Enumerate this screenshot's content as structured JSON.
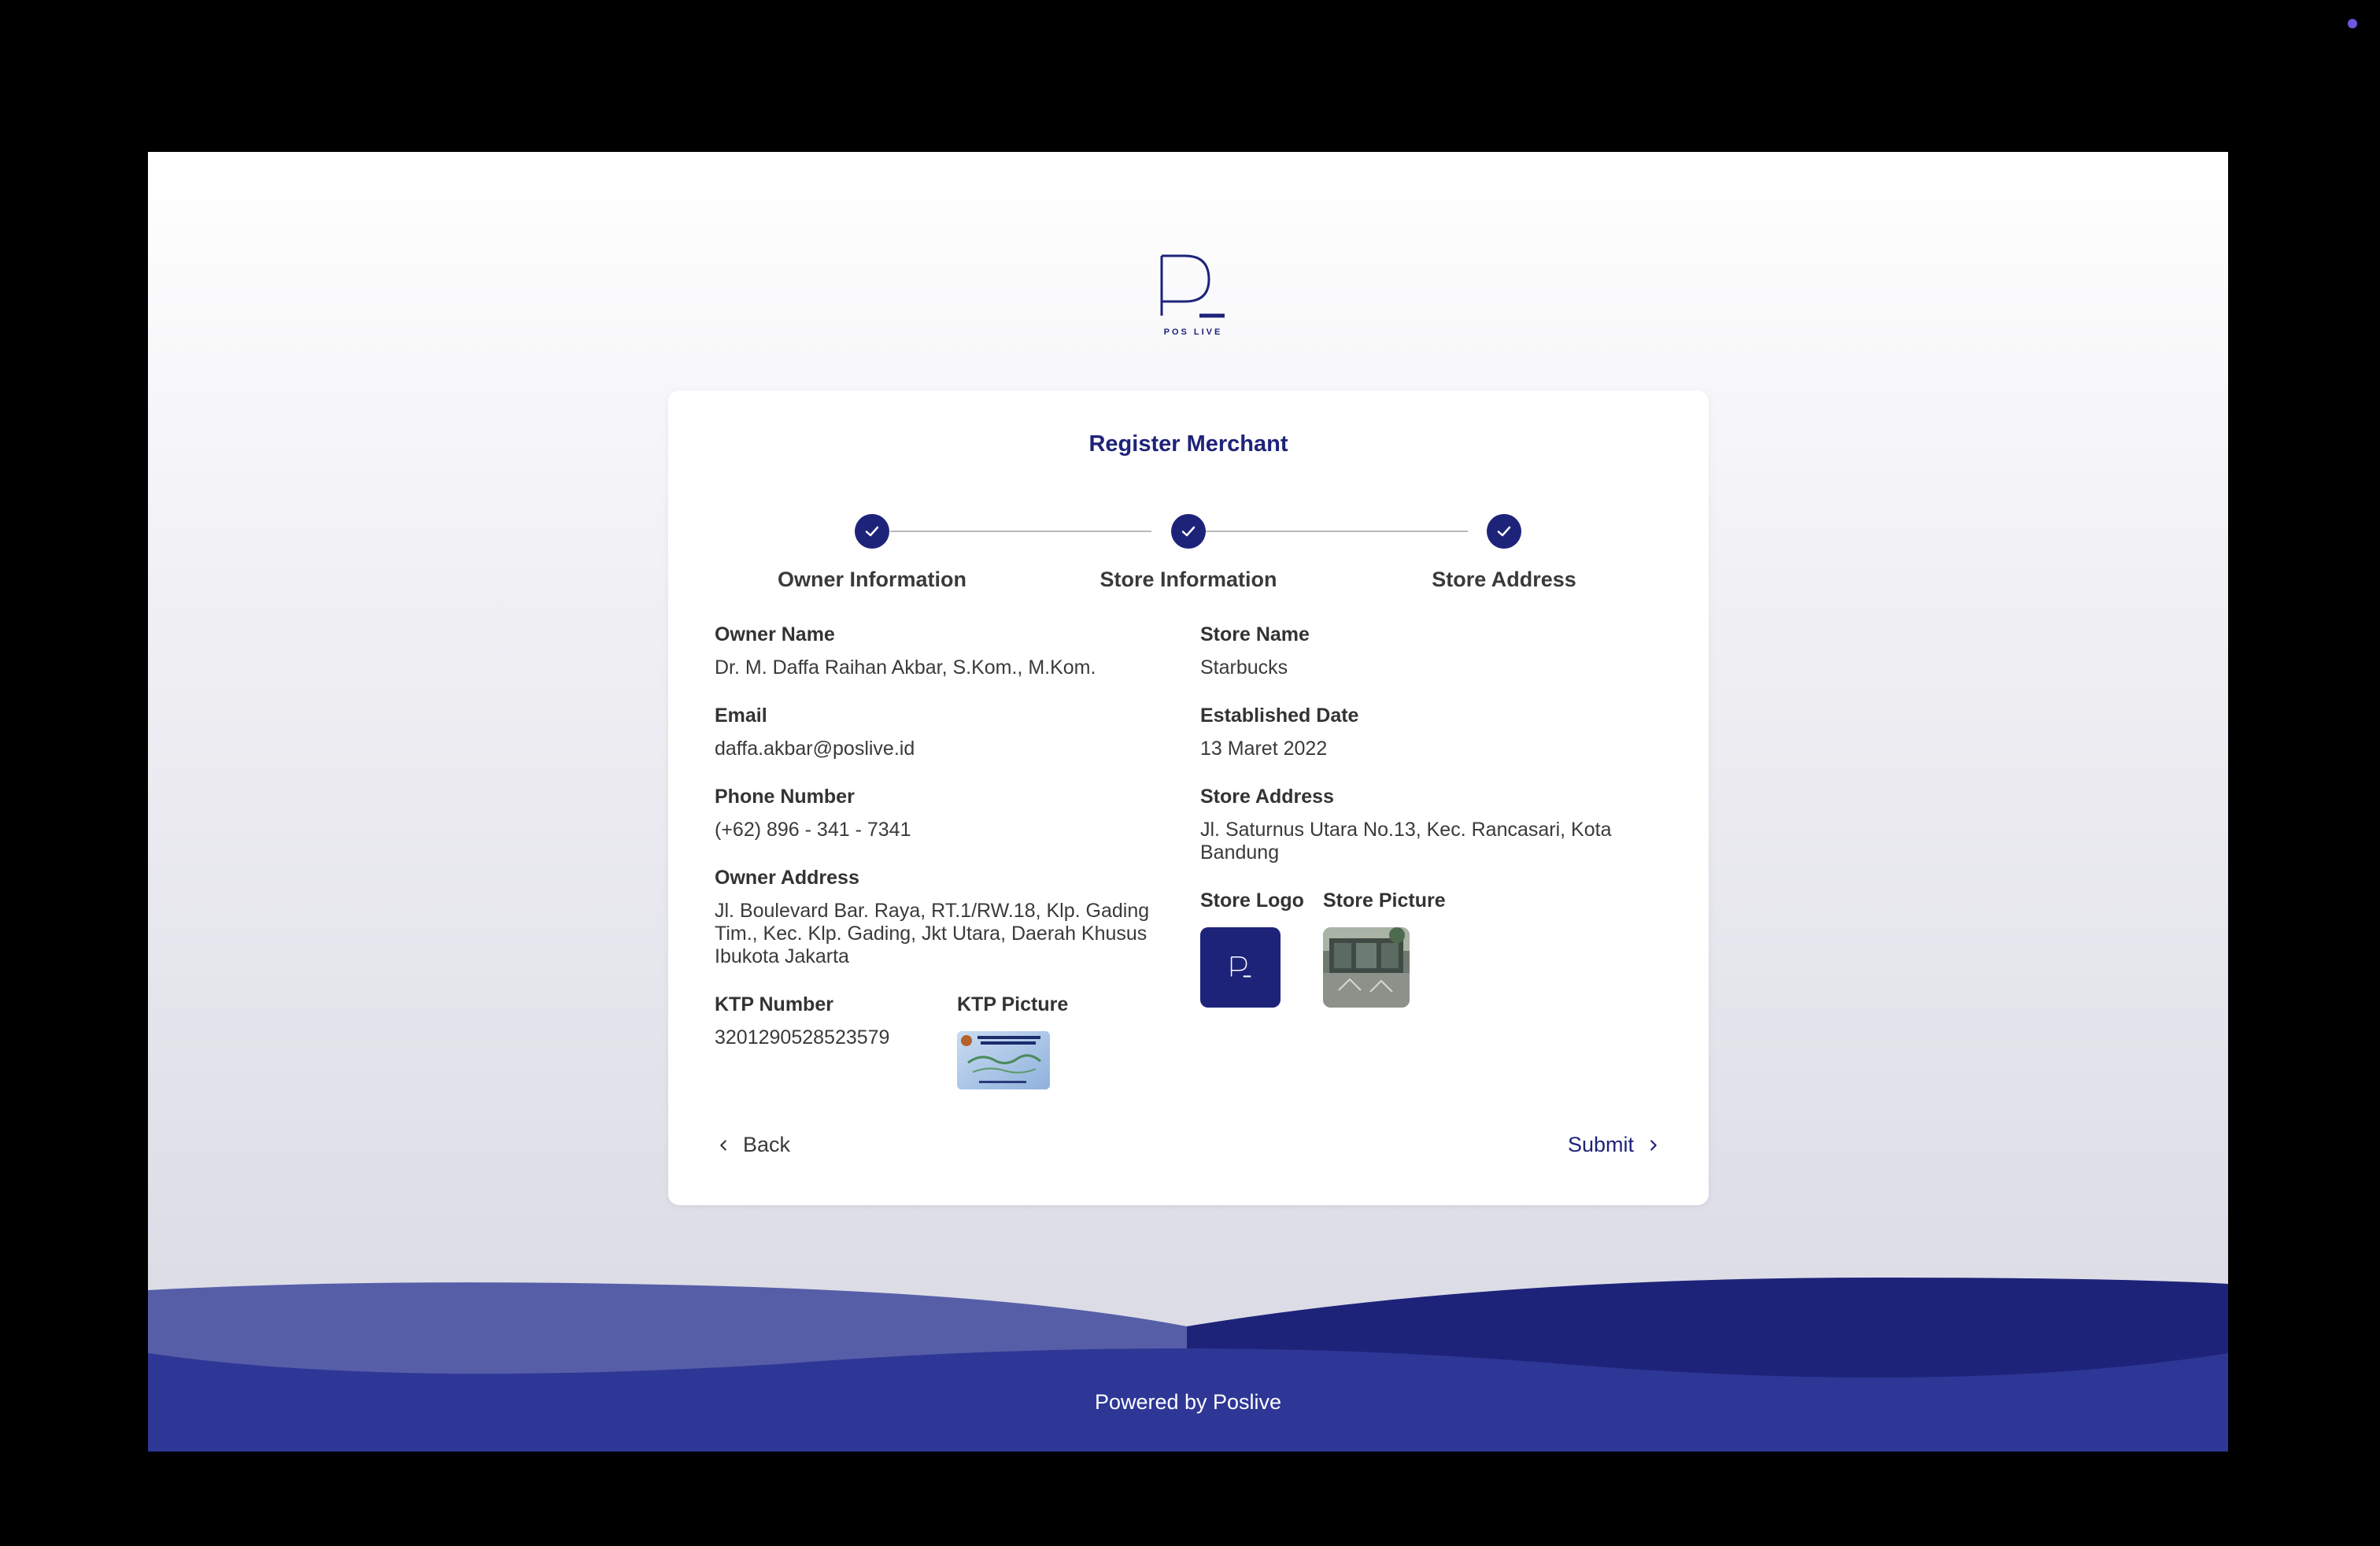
{
  "brand": {
    "logo_text": "POS LIVE",
    "primary_color": "#1e237a"
  },
  "form": {
    "title": "Register Merchant",
    "steps": [
      {
        "label": "Owner Information",
        "status": "completed"
      },
      {
        "label": "Store Information",
        "status": "completed"
      },
      {
        "label": "Store Address",
        "status": "completed"
      }
    ],
    "owner": {
      "name_label": "Owner Name",
      "name_value": "Dr. M. Daffa Raihan Akbar, S.Kom., M.Kom.",
      "email_label": "Email",
      "email_value": "daffa.akbar@poslive.id",
      "phone_label": "Phone Number",
      "phone_value": "(+62) 896 - 341 - 7341",
      "address_label": "Owner Address",
      "address_value": "Jl. Boulevard Bar. Raya, RT.1/RW.18, Klp. Gading Tim., Kec. Klp. Gading, Jkt Utara, Daerah Khusus Ibukota Jakarta",
      "ktp_number_label": "KTP Number",
      "ktp_number_value": "3201290528523579",
      "ktp_picture_label": "KTP Picture"
    },
    "store": {
      "name_label": "Store Name",
      "name_value": "Starbucks",
      "established_label": "Established Date",
      "established_value": "13 Maret 2022",
      "address_label": "Store Address",
      "address_value": "Jl. Saturnus Utara No.13, Kec. Rancasari, Kota Bandung",
      "logo_label": "Store Logo",
      "picture_label": "Store Picture"
    },
    "actions": {
      "back_label": "Back",
      "submit_label": "Submit"
    }
  },
  "footer": {
    "text": "Powered by Poslive"
  },
  "icons": {
    "step": "check-icon",
    "back": "chevron-left-icon",
    "submit": "chevron-right-icon"
  }
}
